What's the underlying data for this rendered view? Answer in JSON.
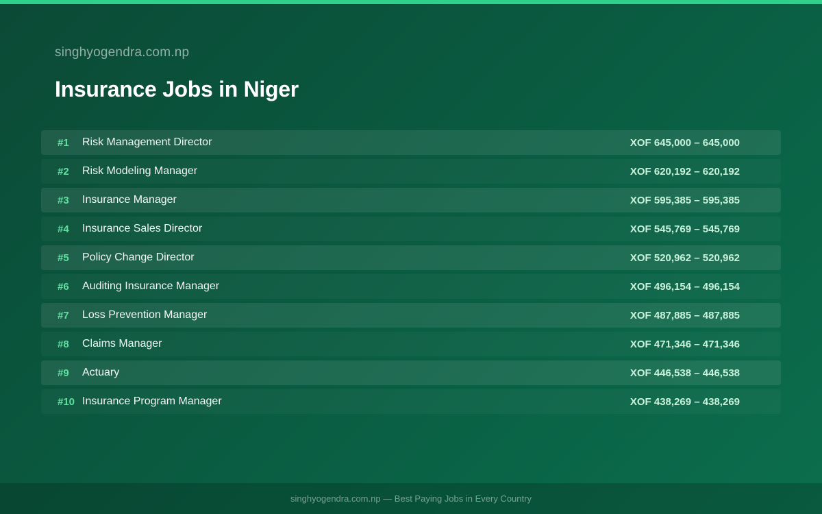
{
  "brand": "singhyogendra.com.np",
  "title": "Insurance Jobs in Niger",
  "jobs": [
    {
      "rank": "#1",
      "title": "Risk Management Director",
      "salary": "XOF 645,000 – 645,000"
    },
    {
      "rank": "#2",
      "title": "Risk Modeling Manager",
      "salary": "XOF 620,192 – 620,192"
    },
    {
      "rank": "#3",
      "title": "Insurance Manager",
      "salary": "XOF 595,385 – 595,385"
    },
    {
      "rank": "#4",
      "title": "Insurance Sales Director",
      "salary": "XOF 545,769 – 545,769"
    },
    {
      "rank": "#5",
      "title": "Policy Change Director",
      "salary": "XOF 520,962 – 520,962"
    },
    {
      "rank": "#6",
      "title": "Auditing Insurance Manager",
      "salary": "XOF 496,154 – 496,154"
    },
    {
      "rank": "#7",
      "title": "Loss Prevention Manager",
      "salary": "XOF 487,885 – 487,885"
    },
    {
      "rank": "#8",
      "title": "Claims Manager",
      "salary": "XOF 471,346 – 471,346"
    },
    {
      "rank": "#9",
      "title": "Actuary",
      "salary": "XOF 446,538 – 446,538"
    },
    {
      "rank": "#10",
      "title": "Insurance Program Manager",
      "salary": "XOF 438,269 – 438,269"
    }
  ],
  "footer": "singhyogendra.com.np — Best Paying Jobs in Every Country",
  "colors": {
    "accent": "#2fd08a",
    "rank": "#5ee0a0",
    "salary": "#c8f2dc",
    "background": "#0a5a40"
  }
}
